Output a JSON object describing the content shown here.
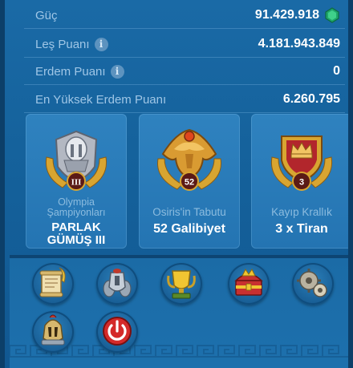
{
  "stats": {
    "power": {
      "label": "Güç",
      "value": "91.429.918",
      "icon": "green-gem-icon"
    },
    "kill_points": {
      "label": "Leş Puanı",
      "value": "4.181.943.849",
      "icon": "info-icon"
    },
    "merit_points": {
      "label": "Erdem Puanı",
      "value": "0",
      "icon": "info-icon"
    },
    "highest_merit": {
      "label": "En Yüksek Erdem Puanı",
      "value": "6.260.795"
    }
  },
  "cards": [
    {
      "title": "Olympia Şampiyonları",
      "value": "PARLAK GÜMÜŞ III",
      "badge_text": "III",
      "icon": "silver-helmet-badge-icon"
    },
    {
      "title": "Osiris'in Tabutu",
      "value": "52 Galibiyet",
      "badge_text": "52",
      "icon": "golden-phoenix-badge-icon"
    },
    {
      "title": "Kayıp Krallık",
      "value": "3 x Tiran",
      "badge_text": "3",
      "icon": "crown-shield-badge-icon"
    }
  ],
  "buttons": [
    {
      "name": "scroll-quill-icon"
    },
    {
      "name": "armies-icon"
    },
    {
      "name": "trophy-icon"
    },
    {
      "name": "treasure-chest-icon"
    },
    {
      "name": "settings-gears-icon"
    },
    {
      "name": "commander-helmet-icon"
    },
    {
      "name": "power-icon"
    }
  ],
  "colors": {
    "panel_bg": "#15629c",
    "card_bg": "#2a7bb9",
    "label": "#9fc6e6",
    "value": "#ffffff",
    "gem": "#1fa56a",
    "power_red": "#d42a2a"
  }
}
